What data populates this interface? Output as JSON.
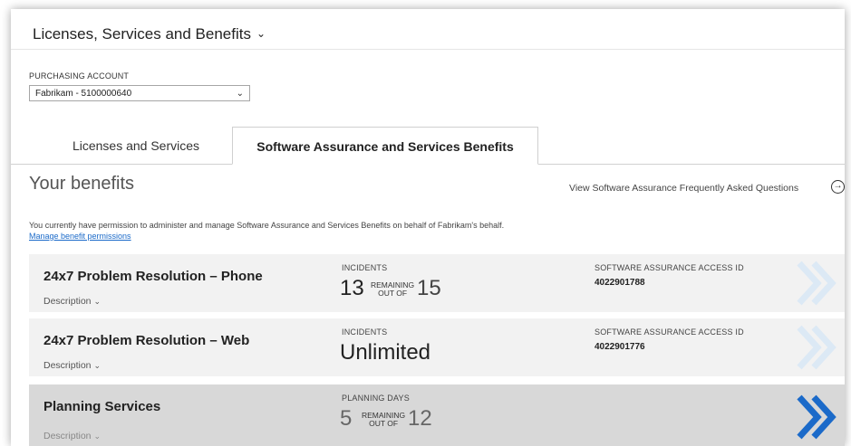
{
  "header": {
    "title": "Licenses, Services and Benefits"
  },
  "purchasing": {
    "label": "PURCHASING ACCOUNT",
    "selected": "Fabrikam - 5100000640"
  },
  "tabs": [
    {
      "label": "Licenses and Services",
      "active": false
    },
    {
      "label": "Software Assurance and Services Benefits",
      "active": true
    }
  ],
  "benefits": {
    "heading": "Your benefits",
    "faq_link": "View Software Assurance Frequently Asked Questions",
    "permission_text": "You currently have permission to administer and manage Software Assurance and Services Benefits on behalf of Fabrikam's behalf.",
    "permission_link": "Manage benefit permissions"
  },
  "cards": [
    {
      "name": "24x7 Problem Resolution – Phone",
      "description": "Description",
      "metric_label": "INCIDENTS",
      "remaining": "13",
      "remaining_word": "REMAINING",
      "out_of_word": "OUT OF",
      "total": "15",
      "access_label": "SOFTWARE ASSURANCE ACCESS ID",
      "access_id": "4022901788",
      "accent": "#dce9f5"
    },
    {
      "name": "24x7 Problem Resolution – Web",
      "description": "Description",
      "metric_label": "INCIDENTS",
      "unlimited": "Unlimited",
      "access_label": "SOFTWARE ASSURANCE ACCESS ID",
      "access_id": "4022901776",
      "accent": "#dce9f5"
    },
    {
      "name": "Planning Services",
      "description": "Description",
      "metric_label": "PLANNING DAYS",
      "remaining": "5",
      "remaining_word": "REMAINING",
      "out_of_word": "OUT OF",
      "total": "12",
      "accent": "#1b6ac9"
    }
  ]
}
